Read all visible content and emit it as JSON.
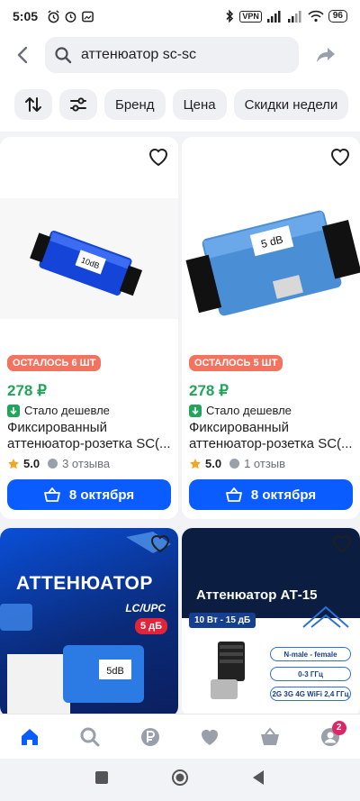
{
  "status_bar": {
    "time": "5:05",
    "vpn": "VPN",
    "battery": "96"
  },
  "search": {
    "query": "аттенюатор sc-sc"
  },
  "filters": {
    "chips": [
      "Бренд",
      "Цена",
      "Скидки недели"
    ]
  },
  "products": [
    {
      "badge": "ОСТАЛОСЬ 6 ШТ",
      "price": "278 ₽",
      "cheaper": "Стало дешевле",
      "title": "Фиксированный аттенюатор-розетка SC(...",
      "rating": "5.0",
      "reviews": "3 отзыва",
      "delivery": "8 октября",
      "device_label": "10dB"
    },
    {
      "badge": "ОСТАЛОСЬ 5 ШТ",
      "price": "278 ₽",
      "cheaper": "Стало дешевле",
      "title": "Фиксированный аттенюатор-розетка SC(...",
      "rating": "5.0",
      "reviews": "1 отзыв",
      "delivery": "8 октября",
      "device_label": "5 dB"
    }
  ],
  "banners": [
    {
      "title": "АТТЕНЮАТОР",
      "subtitle": "LC/UPC",
      "tag": "5 дБ",
      "device_label": "5dB"
    },
    {
      "title": "Аттенюатор АТ-15",
      "band": "10 Вт - 15 дБ",
      "specs": [
        "N-male - female",
        "0-3 ГГц",
        "2G 3G 4G WiFi 2,4 ГГц"
      ]
    }
  ],
  "bottom_nav": {
    "cart_count": "2"
  },
  "colors": {
    "accent_blue": "#0b5cff",
    "price_green": "#22a55b",
    "badge_orange": "#f2735f"
  }
}
